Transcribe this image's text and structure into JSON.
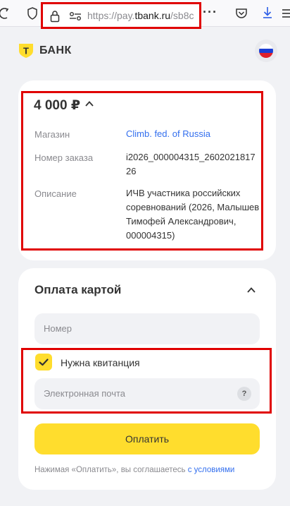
{
  "browser": {
    "url_base": "https://pay.",
    "url_domain": "tbank.ru",
    "url_rest": "/sb8c",
    "more_label": "···"
  },
  "header": {
    "logo_letter": "Т",
    "logo_text": "БАНК",
    "language_flag": [
      "#ffffff",
      "#1c3fd4",
      "#e0202b"
    ]
  },
  "order": {
    "amount": "4 000 ₽",
    "rows": [
      {
        "label": "Магазин",
        "value": "Climb. fed. of Russia"
      },
      {
        "label": "Номер заказа",
        "value": "i2026_000004315_2602021817 26"
      },
      {
        "label": "Описание",
        "value": "ИЧВ участника российских соревнований (2026, Малышев Тимофей Александрович, 000004315)"
      }
    ]
  },
  "payment": {
    "title": "Оплата картой",
    "card_number_placeholder": "Номер",
    "receipt_label": "Нужна квитанция",
    "receipt_checked": true,
    "email_placeholder": "Электронная почта",
    "help_badge": "?",
    "pay_button": "Оплатить",
    "terms_text": "Нажимая «Оплатить», вы соглашаетесь ",
    "terms_link": "с условиями"
  },
  "colors": {
    "accent_yellow": "#ffdd2d",
    "link_blue": "#336fee",
    "highlight_red": "#e00000"
  }
}
